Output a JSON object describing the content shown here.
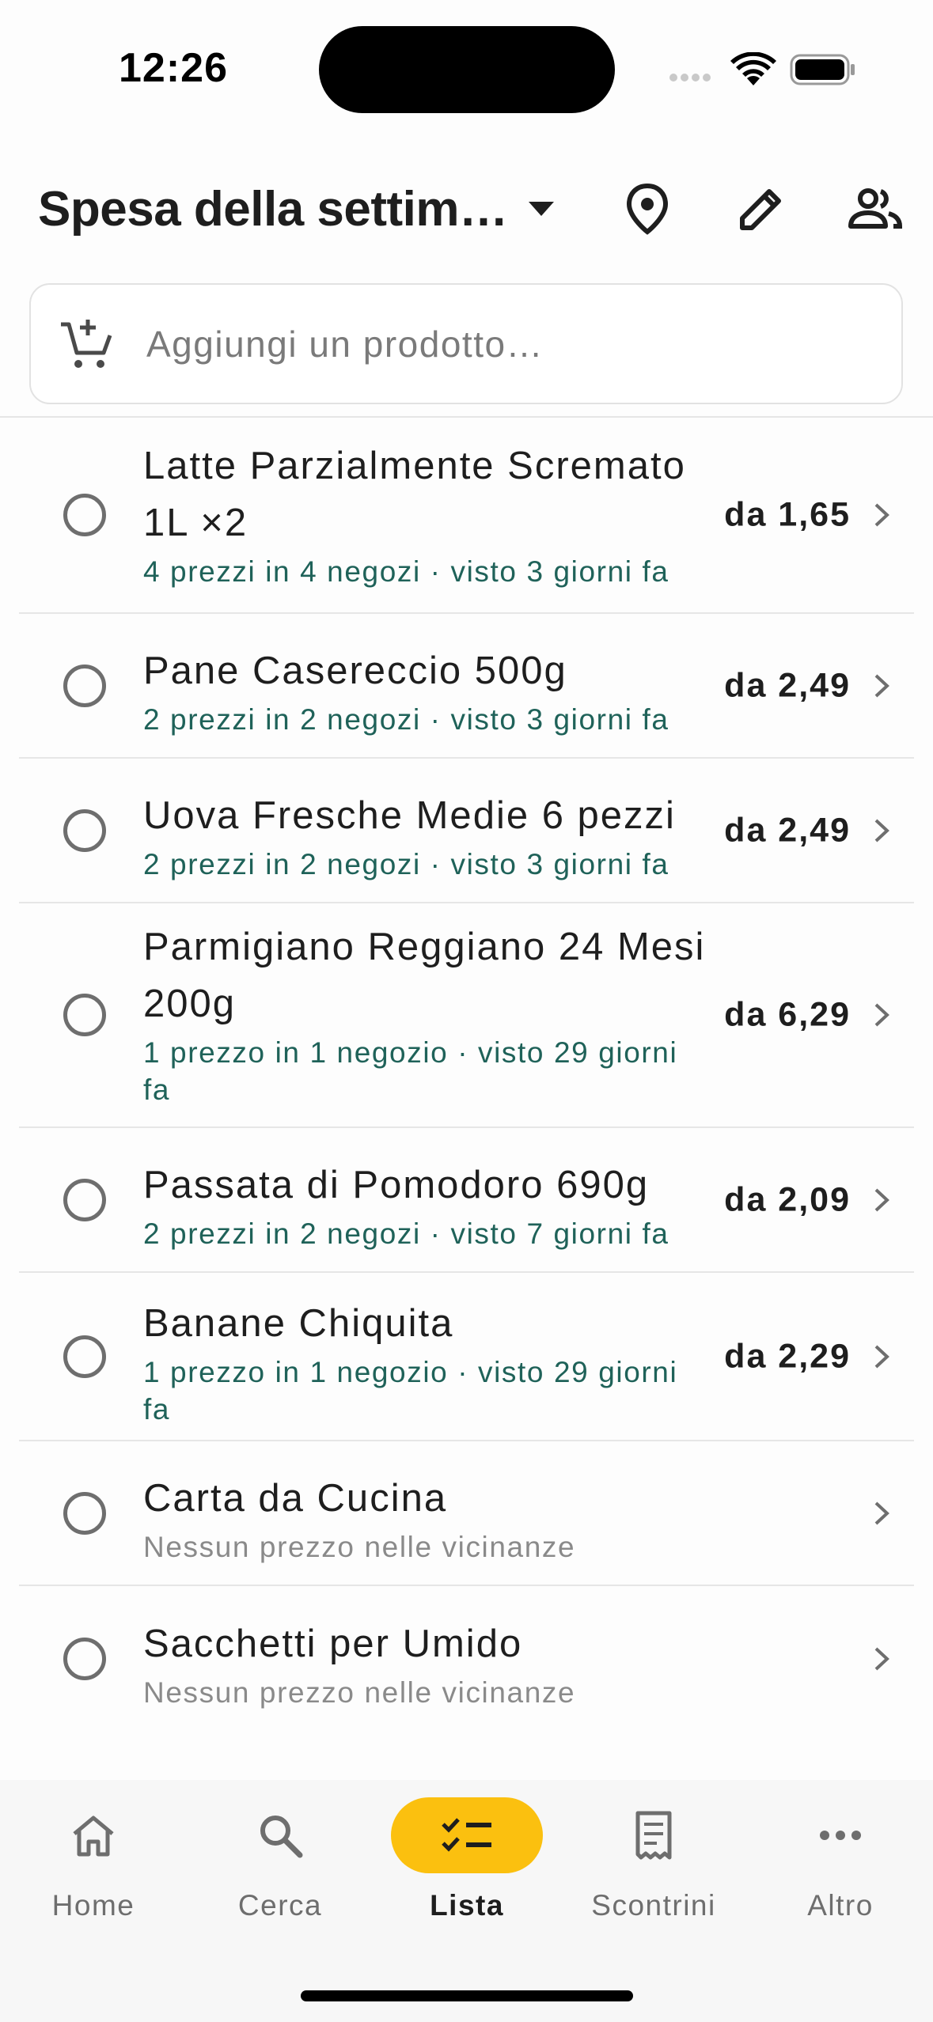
{
  "status_bar": {
    "time": "12:26"
  },
  "header": {
    "title": "Spesa della settim…",
    "icons": [
      "location-pin-icon",
      "edit-pencil-icon",
      "share-people-icon"
    ]
  },
  "add_product": {
    "placeholder": "Aggiungi un prodotto…",
    "icon": "add-cart-icon"
  },
  "items": [
    {
      "name": "Latte Parzialmente Scremato 1L ×2",
      "sub": "4 prezzi in 4 negozi · visto 3 giorni fa",
      "price": "da 1,65"
    },
    {
      "name": "Pane Casereccio 500g",
      "sub": "2 prezzi in 2 negozi · visto 3 giorni fa",
      "price": "da 2,49"
    },
    {
      "name": "Uova Fresche Medie 6 pezzi",
      "sub": "2 prezzi in 2 negozi · visto 3 giorni fa",
      "price": "da 2,49"
    },
    {
      "name": "Parmigiano Reggiano 24 Mesi 200g",
      "sub": "1 prezzo in 1 negozio · visto 29 giorni fa",
      "price": "da 6,29"
    },
    {
      "name": "Passata di Pomodoro 690g",
      "sub": "2 prezzi in 2 negozi · visto 7 giorni fa",
      "price": "da 2,09"
    },
    {
      "name": "Banane Chiquita",
      "sub": "1 prezzo in 1 negozio · visto 29 giorni fa",
      "price": "da 2,29"
    },
    {
      "name": "Carta da Cucina",
      "sub": "Nessun prezzo nelle vicinanze",
      "price": ""
    },
    {
      "name": "Sacchetti per Umido",
      "sub": "Nessun prezzo nelle vicinanze",
      "price": ""
    }
  ],
  "bottom_nav": {
    "home": "Home",
    "search": "Cerca",
    "list": "Lista",
    "receipts": "Scontrini",
    "more": "Altro",
    "active": "list"
  },
  "colors": {
    "accent": "#FBC00F",
    "subtext": "#1F6259",
    "muted": "#8A8A8A"
  }
}
